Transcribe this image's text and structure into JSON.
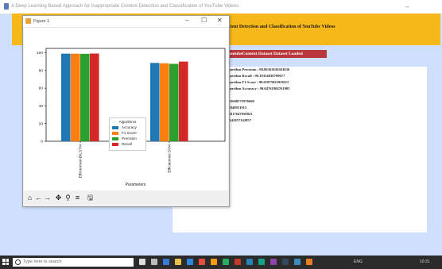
{
  "app_window": {
    "title": "A Deep Learning Based Approach for Inappropriate Content Detection and Classification of YouTube Videos",
    "minimize_glyph": "–"
  },
  "banner": {
    "title": "ontent Detection and Classification of YouTube Videos",
    "color": "#f7b81a"
  },
  "status": {
    "text": "YoutubeContent Dataset Dataset Loaded",
    "color": "#b8383c"
  },
  "results": {
    "lines": [
      "STM Algorithm Precision : 98.86363636363636",
      "STM Algorithm Recall    : 99.19354838709677",
      "STM Algorithm F1-Score  : 99.01875025928115",
      "STM Algorithm Accuracy  : 99.04761904761905",
      "ion : 87.55668575976660",
      ": 90.0904040931915",
      "re : 88.14117647058823",
      "y : 88.57142857142857"
    ]
  },
  "figure_window": {
    "title": "Figure 1",
    "controls": {
      "minimize": "–",
      "maximize": "☐",
      "close": "✕"
    }
  },
  "chart_data": {
    "type": "bar",
    "categories": [
      "Efficientnet-BiLSTM",
      "Efficientnet-SVM"
    ],
    "series": [
      {
        "name": "Accuracy",
        "color": "#1f77b4",
        "values": [
          99.05,
          88.57
        ]
      },
      {
        "name": "F1 Score",
        "color": "#ff7f0e",
        "values": [
          99.02,
          88.14
        ]
      },
      {
        "name": "Precision",
        "color": "#2ca02c",
        "values": [
          98.86,
          87.56
        ]
      },
      {
        "name": "Recall",
        "color": "#d62728",
        "values": [
          99.19,
          90.09
        ]
      }
    ],
    "title": "",
    "xlabel": "Parameters",
    "ylabel": "",
    "ylim": [
      0,
      105
    ],
    "yticks": [
      0,
      20,
      40,
      60,
      80,
      100
    ],
    "legend_title": "Algorithms",
    "legend_position": "center"
  },
  "figure_toolbar": {
    "icons": [
      "home-icon",
      "back-icon",
      "forward-icon",
      "pan-icon",
      "zoom-icon",
      "configure-icon",
      "save-icon"
    ],
    "glyphs": [
      "⌂",
      "←",
      "→",
      "✥",
      "⚲",
      "≡",
      "🖫"
    ]
  },
  "taskbar": {
    "search_placeholder": "Type here to search",
    "time": "10:31",
    "tray_text": "ENG"
  }
}
